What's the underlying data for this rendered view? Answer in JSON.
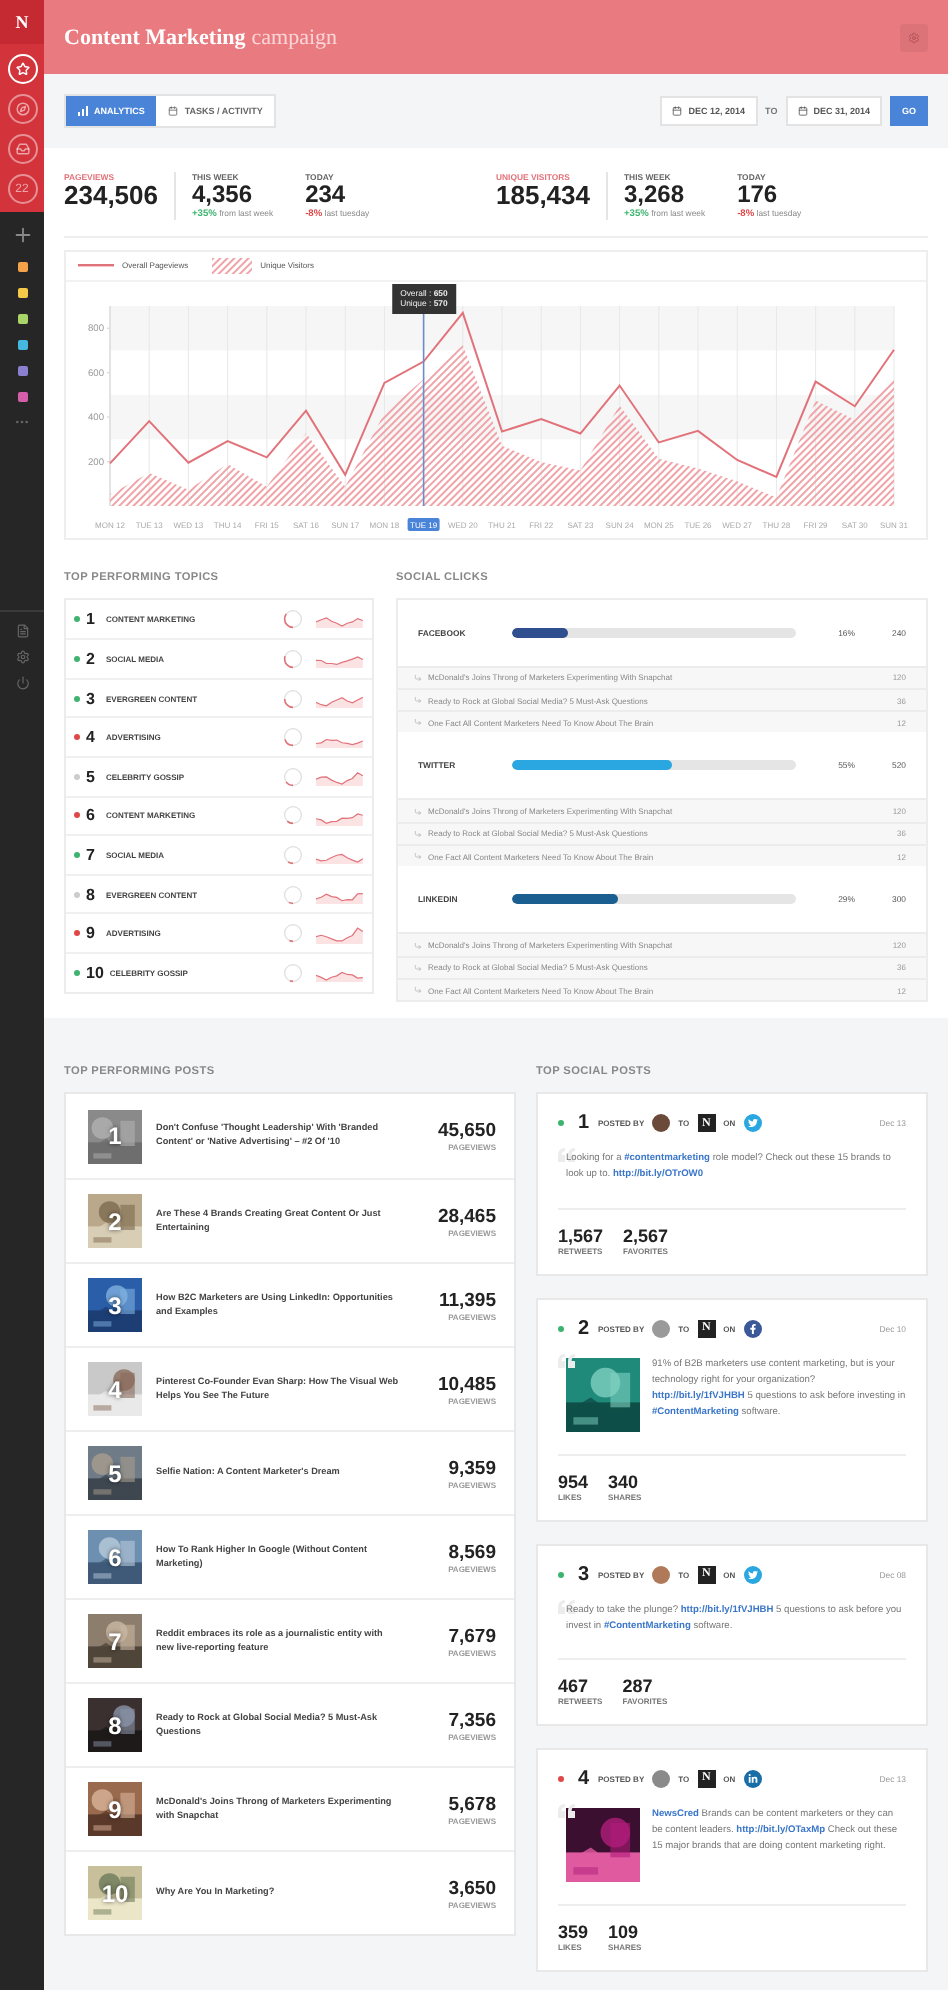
{
  "sidebar": {
    "logo": "N",
    "nav": [
      {
        "selected": true
      },
      {
        "selected": false
      },
      {
        "selected": false
      },
      {
        "selected": false,
        "count": "22"
      }
    ],
    "projects": [
      {
        "color": "#f5a34a"
      },
      {
        "color": "#f7c948"
      },
      {
        "color": "#a8d468"
      },
      {
        "color": "#45b8e0"
      },
      {
        "color": "#8b7fd0"
      },
      {
        "color": "#d45fa8"
      }
    ]
  },
  "header": {
    "title": "Content Marketing",
    "subtitle": "campaign"
  },
  "toolbar": {
    "tabs": [
      {
        "label": "ANALYTICS",
        "selected": true
      },
      {
        "label": "TASKS / ACTIVITY",
        "selected": false
      }
    ],
    "date_from": "DEC 12, 2014",
    "separator": "TO",
    "date_to": "DEC 31, 2014",
    "go": "GO"
  },
  "stats": [
    {
      "label": "PAGEVIEWS",
      "value": "234,506",
      "periods": [
        {
          "label": "THIS WEEK",
          "value": "4,356",
          "change": "+35%",
          "note": "from last week",
          "color": "#3cb46e"
        },
        {
          "label": "TODAY",
          "value": "234",
          "change": "-8%",
          "note": "last tuesday",
          "color": "#e04848"
        }
      ]
    },
    {
      "label": "UNIQUE VISITORS",
      "value": "185,434",
      "periods": [
        {
          "label": "THIS WEEK",
          "value": "3,268",
          "change": "+35%",
          "note": "from last week",
          "color": "#3cb46e"
        },
        {
          "label": "TODAY",
          "value": "176",
          "change": "-8%",
          "note": "last tuesday",
          "color": "#e04848"
        }
      ]
    }
  ],
  "traffic": {
    "chart_data": {
      "type": "line",
      "categories": [
        "MON 12",
        "TUE 13",
        "WED 13",
        "THU 14",
        "FRI 15",
        "SAT 16",
        "SUN 17",
        "MON 18",
        "TUE 19",
        "WED 20",
        "THU 21",
        "FRI 22",
        "SAT 23",
        "SUN 24",
        "MON 25",
        "TUE 26",
        "WED 27",
        "THU 28",
        "FRI 29",
        "SAT 30",
        "SUN 31"
      ],
      "series": [
        {
          "name": "Overall Pageviews",
          "type": "line",
          "color": "#e2727a",
          "values": [
            192,
            382,
            195,
            292,
            219,
            429,
            140,
            554,
            650,
            869,
            335,
            391,
            326,
            542,
            286,
            338,
            207,
            131,
            560,
            449,
            703
          ]
        },
        {
          "name": "Unique Visitors",
          "type": "area",
          "color": "#f0a3a8",
          "values": [
            52,
            149,
            73,
            189,
            87,
            329,
            87,
            417,
            570,
            723,
            271,
            198,
            160,
            452,
            213,
            169,
            111,
            38,
            475,
            388,
            577
          ]
        }
      ],
      "ylim": [
        0,
        900
      ],
      "yticks": [
        200,
        400,
        600,
        800
      ],
      "bands": [
        {
          "axis": "y",
          "from": 700,
          "to": 900
        },
        {
          "axis": "y",
          "from": 300,
          "to": 500
        }
      ],
      "grid": true,
      "legend": "top",
      "annotations": [
        {
          "x": "TUE 19",
          "text": "Overall : **650**\nUnique : **570**"
        }
      ]
    }
  },
  "topics": {
    "title": "TOP PERFORMING TOPICS",
    "items": [
      {
        "rank": "1",
        "name": "CONTENT MARKETING",
        "color": "#3cb46e"
      },
      {
        "rank": "2",
        "name": "SOCIAL MEDIA",
        "color": "#3cb46e"
      },
      {
        "rank": "3",
        "name": "EVERGREEN CONTENT",
        "color": "#3cb46e"
      },
      {
        "rank": "4",
        "name": "ADVERTISING",
        "color": "#e04848"
      },
      {
        "rank": "5",
        "name": "CELEBRITY GOSSIP",
        "color": "#cccccc"
      },
      {
        "rank": "6",
        "name": "CONTENT MARKETING",
        "color": "#e04848"
      },
      {
        "rank": "7",
        "name": "SOCIAL MEDIA",
        "color": "#3cb46e"
      },
      {
        "rank": "8",
        "name": "EVERGREEN CONTENT",
        "color": "#cccccc"
      },
      {
        "rank": "9",
        "name": "ADVERTISING",
        "color": "#e04848"
      },
      {
        "rank": "10",
        "name": "CELEBRITY GOSSIP",
        "color": "#3cb46e"
      }
    ]
  },
  "social_clicks": {
    "title": "SOCIAL CLICKS",
    "networks": [
      {
        "name": "FACEBOOK",
        "color": "#2f4f8f",
        "level": 0.2,
        "percent": "16%",
        "count": "240",
        "posts": [
          {
            "title": "McDonald's Joins Throng of Marketers Experimenting With Snapchat",
            "count": "120"
          },
          {
            "title": "Ready to Rock at Global Social Media? 5 Must-Ask Questions",
            "count": "36"
          },
          {
            "title": "One Fact All Content Marketers Need To Know About The Brain",
            "count": "12"
          }
        ]
      },
      {
        "name": "TWITTER",
        "color": "#2aa7e0",
        "level": 0.56,
        "percent": "55%",
        "count": "520",
        "posts": [
          {
            "title": "McDonald's Joins Throng of Marketers Experimenting With Snapchat",
            "count": "120"
          },
          {
            "title": "Ready to Rock at Global Social Media? 5 Must-Ask Questions",
            "count": "36"
          },
          {
            "title": "One Fact All Content Marketers Need To Know About The Brain",
            "count": "12"
          }
        ]
      },
      {
        "name": "LINKEDIN",
        "color": "#1a5f8f",
        "level": 0.37,
        "percent": "29%",
        "count": "300",
        "posts": [
          {
            "title": "McDonald's Joins Throng of Marketers Experimenting With Snapchat",
            "count": "120"
          },
          {
            "title": "Ready to Rock at Global Social Media? 5 Must-Ask Questions",
            "count": "36"
          },
          {
            "title": "One Fact All Content Marketers Need To Know About The Brain",
            "count": "12"
          }
        ]
      }
    ]
  },
  "top_posts": {
    "title": "TOP PERFORMING POSTS",
    "items": [
      {
        "rank": "1",
        "title": "Don't Confuse 'Thought Leadership' With 'Branded Content' or 'Native Advertising' – #2 Of '10",
        "value": "45,650",
        "unit": "PAGEVIEWS"
      },
      {
        "rank": "2",
        "title": "Are These 4 Brands Creating Great Content Or Just Entertaining",
        "value": "28,465",
        "unit": "PAGEVIEWS"
      },
      {
        "rank": "3",
        "title": "How B2C Marketers are Using LinkedIn: Opportunities and Examples",
        "value": "11,395",
        "unit": "PAGEVIEWS"
      },
      {
        "rank": "4",
        "title": "Pinterest Co-Founder Evan Sharp: How The Visual Web Helps You See The Future",
        "value": "10,485",
        "unit": "PAGEVIEWS"
      },
      {
        "rank": "5",
        "title": "Selfie Nation: A Content Marketer's Dream",
        "value": "9,359",
        "unit": "PAGEVIEWS"
      },
      {
        "rank": "6",
        "title": "How To Rank Higher In Google (Without Content Marketing)",
        "value": "8,569",
        "unit": "PAGEVIEWS"
      },
      {
        "rank": "7",
        "title": "Reddit embraces its role as a journalistic entity with new live-reporting feature",
        "value": "7,679",
        "unit": "PAGEVIEWS"
      },
      {
        "rank": "8",
        "title": "Ready to Rock at Global Social Media? 5 Must-Ask Questions",
        "value": "7,356",
        "unit": "PAGEVIEWS"
      },
      {
        "rank": "9",
        "title": "McDonald's Joins Throng of Marketers Experimenting with Snapchat",
        "value": "5,678",
        "unit": "PAGEVIEWS"
      },
      {
        "rank": "10",
        "title": "Why Are You In Marketing?",
        "value": "3,650",
        "unit": "PAGEVIEWS"
      }
    ]
  },
  "social_posts": {
    "title": "TOP SOCIAL POSTS",
    "items": [
      {
        "color": "#3cb46e",
        "rank": "1",
        "posted_by": "POSTED BY",
        "to": "TO",
        "to_logo": "N",
        "on": "ON",
        "kind": "twitter",
        "date": "Dec 13",
        "picture": false,
        "text": [
          {
            "kind": "plain",
            "text": "Looking for a "
          },
          {
            "kind": "hashtag",
            "text": "#contentmarketing"
          },
          {
            "kind": "plain",
            "text": " role model? Check out these 15 brands to look up to. "
          },
          {
            "kind": "link",
            "text": "http://bit.ly/OTrOW0"
          }
        ],
        "stats": [
          {
            "value": "1,567",
            "label": "RETWEETS"
          },
          {
            "value": "2,567",
            "label": "FAVORITES"
          }
        ]
      },
      {
        "color": "#3cb46e",
        "rank": "2",
        "posted_by": "POSTED BY",
        "to": "TO",
        "to_logo": "N",
        "on": "ON",
        "kind": "facebook",
        "date": "Dec 10",
        "picture": true,
        "text": [
          {
            "kind": "plain",
            "text": "91% of B2B marketers use content marketing, but is your technology right for your organization? "
          },
          {
            "kind": "link",
            "text": "http://bit.ly/1fVJHBH"
          },
          {
            "kind": "plain",
            "text": " 5 questions to ask before investing in "
          },
          {
            "kind": "hashtag",
            "text": "#ContentMarketing"
          },
          {
            "kind": "plain",
            "text": " software."
          }
        ],
        "stats": [
          {
            "value": "954",
            "label": "LIKES"
          },
          {
            "value": "340",
            "label": "SHARES"
          }
        ]
      },
      {
        "color": "#3cb46e",
        "rank": "3",
        "posted_by": "POSTED BY",
        "to": "TO",
        "to_logo": "N",
        "on": "ON",
        "kind": "twitter",
        "date": "Dec 08",
        "picture": false,
        "text": [
          {
            "kind": "plain",
            "text": "Ready to take the plunge? "
          },
          {
            "kind": "link",
            "text": "http://bit.ly/1fVJHBH"
          },
          {
            "kind": "plain",
            "text": " 5 questions to ask before you invest in "
          },
          {
            "kind": "hashtag",
            "text": "#ContentMarketing"
          },
          {
            "kind": "plain",
            "text": " software."
          }
        ],
        "stats": [
          {
            "value": "467",
            "label": "RETWEETS"
          },
          {
            "value": "287",
            "label": "FAVORITES"
          }
        ]
      },
      {
        "color": "#e04848",
        "rank": "4",
        "posted_by": "POSTED BY",
        "to": "TO",
        "to_logo": "N",
        "on": "ON",
        "kind": "linkedin",
        "date": "Dec 13",
        "picture": true,
        "text": [
          {
            "kind": "mention",
            "text": "NewsCred"
          },
          {
            "kind": "plain",
            "text": " Brands can be content marketers or they can be content leaders. "
          },
          {
            "kind": "link",
            "text": "http://bit.ly/OTaxMp"
          },
          {
            "kind": "plain",
            "text": " Check out these 15 major brands that are doing content marketing right."
          }
        ],
        "stats": [
          {
            "value": "359",
            "label": "LIKES"
          },
          {
            "value": "109",
            "label": "SHARES"
          }
        ]
      }
    ]
  }
}
